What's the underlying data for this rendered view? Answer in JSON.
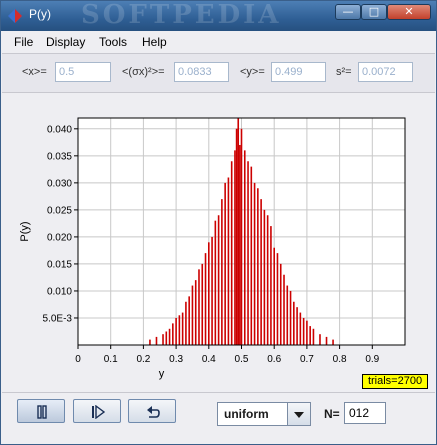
{
  "window": {
    "title": "P(y)",
    "watermark": "SOFTPEDIA",
    "buttons": {
      "minimize": "—",
      "maximize": "□",
      "close": "✕"
    }
  },
  "menu": [
    "File",
    "Display",
    "Tools",
    "Help"
  ],
  "stats": [
    {
      "label": "<x>=",
      "value": "0.5"
    },
    {
      "label": "<(σx)²>=",
      "value": "0.0833"
    },
    {
      "label": "<y>=",
      "value": "0.499"
    },
    {
      "label": "s²=",
      "value": "0.0072"
    }
  ],
  "chart_data": {
    "type": "bar",
    "xlabel": "y",
    "ylabel": "P(y)",
    "xlim": [
      0,
      1
    ],
    "ylim": [
      0,
      0.042
    ],
    "xticks": [
      "0",
      "0.1",
      "0.2",
      "0.3",
      "0.4",
      "0.5",
      "0.6",
      "0.7",
      "0.8",
      "0.9"
    ],
    "yticks": [
      "5.0E-3",
      "0.010",
      "0.015",
      "0.020",
      "0.025",
      "0.030",
      "0.035",
      "0.040"
    ],
    "grid": true,
    "color": "#cc0000",
    "x": [
      0.22,
      0.24,
      0.26,
      0.27,
      0.28,
      0.29,
      0.3,
      0.31,
      0.32,
      0.33,
      0.34,
      0.35,
      0.36,
      0.37,
      0.38,
      0.39,
      0.4,
      0.41,
      0.42,
      0.43,
      0.44,
      0.45,
      0.46,
      0.47,
      0.48,
      0.485,
      0.49,
      0.495,
      0.5,
      0.51,
      0.52,
      0.53,
      0.54,
      0.55,
      0.56,
      0.57,
      0.58,
      0.59,
      0.6,
      0.61,
      0.62,
      0.63,
      0.64,
      0.65,
      0.66,
      0.67,
      0.68,
      0.69,
      0.7,
      0.71,
      0.72,
      0.74,
      0.76,
      0.78
    ],
    "values": [
      0.001,
      0.0015,
      0.002,
      0.0025,
      0.003,
      0.004,
      0.005,
      0.0055,
      0.006,
      0.008,
      0.009,
      0.011,
      0.012,
      0.014,
      0.015,
      0.017,
      0.019,
      0.02,
      0.023,
      0.024,
      0.027,
      0.03,
      0.031,
      0.034,
      0.036,
      0.04,
      0.042,
      0.037,
      0.04,
      0.036,
      0.034,
      0.033,
      0.03,
      0.029,
      0.027,
      0.025,
      0.024,
      0.022,
      0.018,
      0.017,
      0.015,
      0.013,
      0.011,
      0.01,
      0.008,
      0.007,
      0.006,
      0.005,
      0.0045,
      0.0035,
      0.003,
      0.002,
      0.0015,
      0.001
    ]
  },
  "trials_label": "trials=2700",
  "controls": {
    "pause": "pause-icon",
    "step": "step-icon",
    "reset": "reset-icon",
    "distribution": "uniform",
    "n_label": "N=",
    "n_value": "012"
  }
}
